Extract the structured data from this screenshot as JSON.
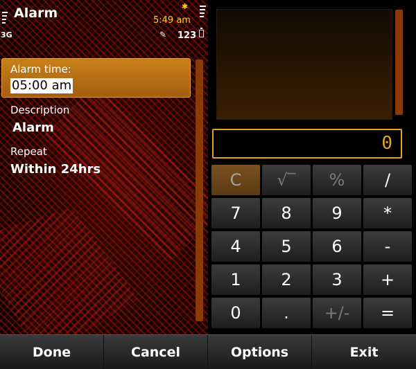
{
  "status": {
    "network": "3G",
    "time": "5:49 am",
    "input_mode": "123"
  },
  "app": {
    "title": "Alarm"
  },
  "form": {
    "alarm_time": {
      "label": "Alarm time:",
      "value": "05:00 am"
    },
    "description": {
      "label": "Description",
      "value": "Alarm"
    },
    "repeat": {
      "label": "Repeat",
      "value": "Within 24hrs"
    }
  },
  "calculator": {
    "result": "0",
    "keys": [
      [
        "C",
        "√‾",
        "%",
        "/"
      ],
      [
        "7",
        "8",
        "9",
        "*"
      ],
      [
        "4",
        "5",
        "6",
        "-"
      ],
      [
        "1",
        "2",
        "3",
        "+"
      ],
      [
        "0",
        ".",
        "+/-",
        "="
      ]
    ]
  },
  "softkeys": {
    "done": "Done",
    "cancel": "Cancel",
    "options": "Options",
    "exit": "Exit"
  },
  "colors": {
    "accent": "#e6a418",
    "highlight": "#c9801a",
    "clock": "#ffd21a"
  }
}
